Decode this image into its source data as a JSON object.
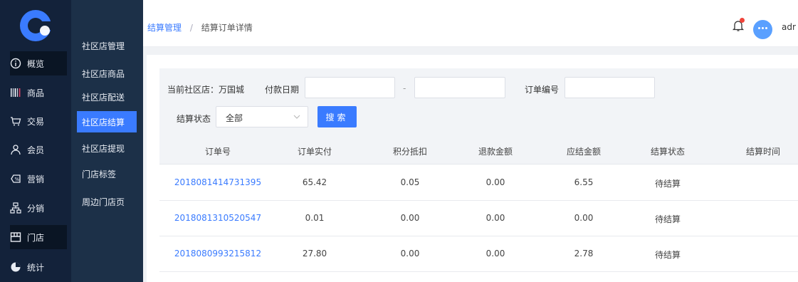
{
  "brand_color": "#3a7bff",
  "main_nav": [
    {
      "label": "概览",
      "icon": "info-icon",
      "active": true
    },
    {
      "label": "商品",
      "icon": "barcode-icon",
      "active": false
    },
    {
      "label": "交易",
      "icon": "cart-icon",
      "active": false
    },
    {
      "label": "会员",
      "icon": "user-icon",
      "active": false
    },
    {
      "label": "营销",
      "icon": "discount-icon",
      "active": false
    },
    {
      "label": "分销",
      "icon": "network-icon",
      "active": false
    },
    {
      "label": "门店",
      "icon": "store-icon",
      "active": true
    },
    {
      "label": "统计",
      "icon": "pie-chart-icon",
      "active": false
    }
  ],
  "sub_nav": [
    {
      "label": "社区店管理",
      "active": false
    },
    {
      "label": "社区店商品",
      "active": false
    },
    {
      "label": "社区店配送",
      "active": false
    },
    {
      "label": "社区店结算",
      "active": true
    },
    {
      "label": "社区店提现",
      "active": false
    },
    {
      "label": "门店标签",
      "active": false
    },
    {
      "label": "周边门店页",
      "active": false
    }
  ],
  "header": {
    "breadcrumb": [
      "结算管理",
      "结算订单详情"
    ],
    "breadcrumb_sep": "/",
    "user": "adr",
    "notification": true
  },
  "filter": {
    "current_store_label": "当前社区店：万国城",
    "pay_date_label": "付款日期",
    "pay_date_start": "",
    "pay_date_end": "",
    "date_sep": "-",
    "order_no_label": "订单编号",
    "order_no_value": "",
    "status_label": "结算状态",
    "status_selected": "全部",
    "search_button": "搜索"
  },
  "table": {
    "columns": [
      "订单号",
      "订单实付",
      "积分抵扣",
      "退款金额",
      "应结金额",
      "结算状态",
      "结算时间"
    ],
    "rows": [
      [
        "2018081414731395",
        "65.42",
        "0.05",
        "0.00",
        "6.55",
        "待结算",
        ""
      ],
      [
        "2018081310520547",
        "0.01",
        "0.00",
        "0.00",
        "0.00",
        "待结算",
        ""
      ],
      [
        "2018080993215812",
        "27.80",
        "0.00",
        "0.00",
        "2.78",
        "待结算",
        ""
      ]
    ]
  }
}
